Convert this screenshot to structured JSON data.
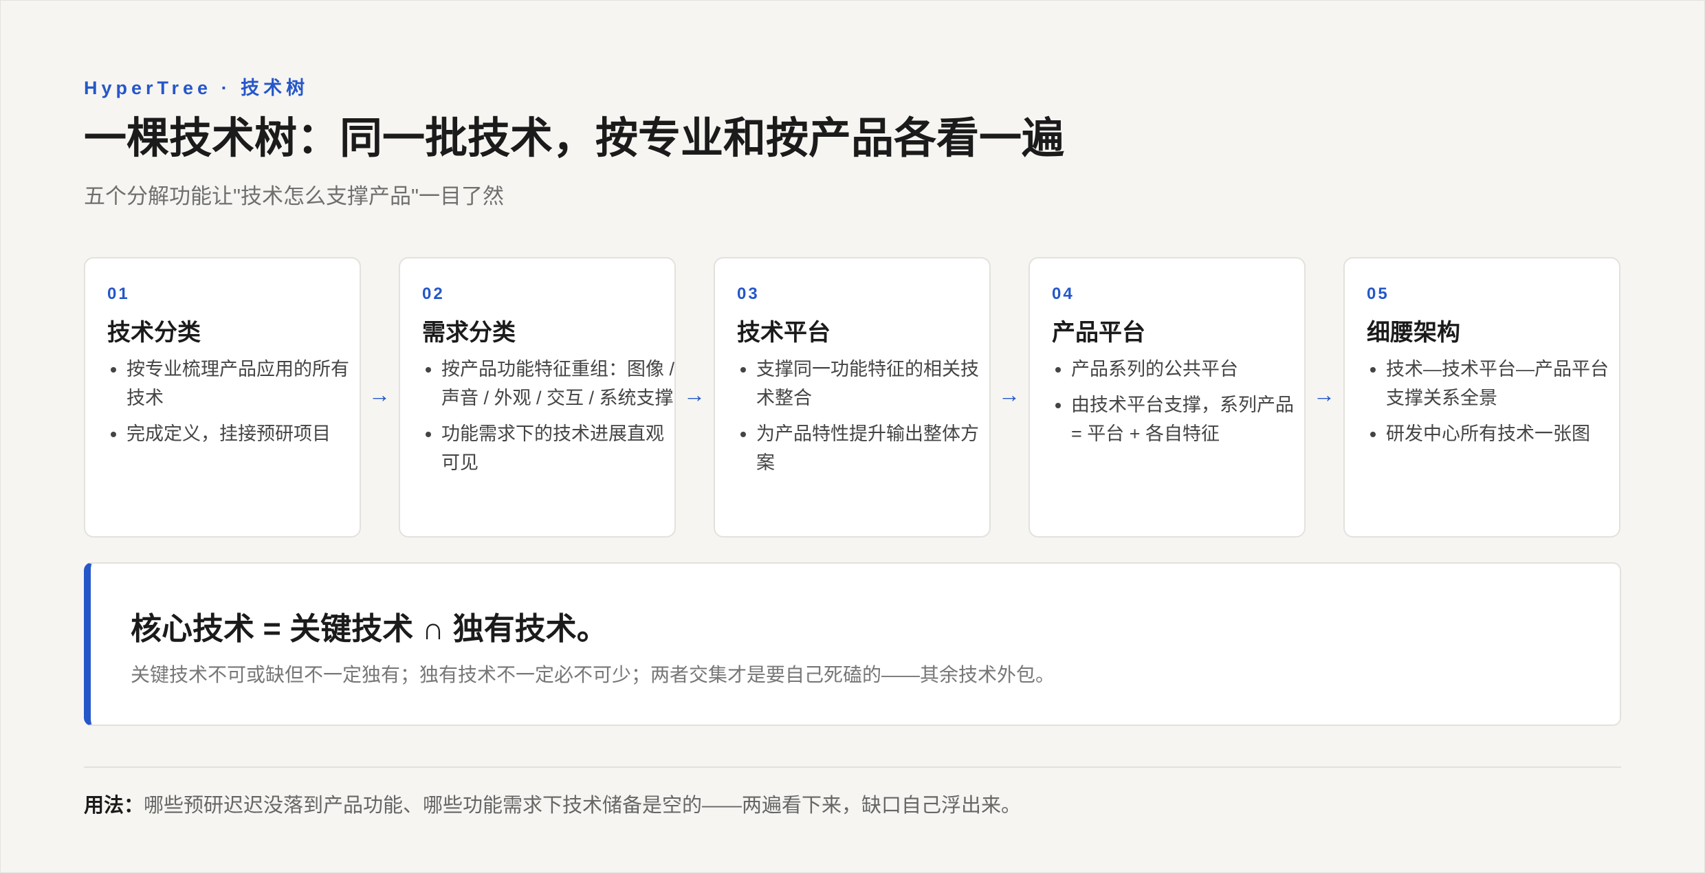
{
  "header": {
    "kicker": "HyperTree · 技术树",
    "title": "一棵技术树：同一批技术，按专业和按产品各看一遍",
    "subtitle": "五个分解功能让\"技术怎么支撑产品\"一目了然"
  },
  "steps": [
    {
      "num": "01",
      "title": "技术分类",
      "items": [
        "按专业梳理产品应用的所有技术",
        "完成定义，挂接预研项目"
      ]
    },
    {
      "num": "02",
      "title": "需求分类",
      "items": [
        "按产品功能特征重组：图像 / 声音 / 外观 / 交互 / 系统支撑",
        "功能需求下的技术进展直观可见"
      ]
    },
    {
      "num": "03",
      "title": "技术平台",
      "items": [
        "支撑同一功能特征的相关技术整合",
        "为产品特性提升输出整体方案"
      ]
    },
    {
      "num": "04",
      "title": "产品平台",
      "items": [
        "产品系列的公共平台",
        "由技术平台支撑，系列产品 = 平台 + 各自特征"
      ]
    },
    {
      "num": "05",
      "title": "细腰架构",
      "items": [
        "技术—技术平台—产品平台支撑关系全景",
        "研发中心所有技术一张图"
      ]
    }
  ],
  "arrow_glyph": "→",
  "core": {
    "title": "核心技术 = 关键技术 ∩ 独有技术。",
    "desc": "关键技术不可或缺但不一定独有；独有技术不一定必不可少；两者交集才是要自己死磕的——其余技术外包。"
  },
  "footer": {
    "label": "用法：",
    "text": "哪些预研迟迟没落到产品功能、哪些功能需求下技术储备是空的——两遍看下来，缺口自己浮出来。"
  },
  "colors": {
    "accent": "#2557c9",
    "background": "#f6f5f2",
    "card": "#ffffff"
  }
}
